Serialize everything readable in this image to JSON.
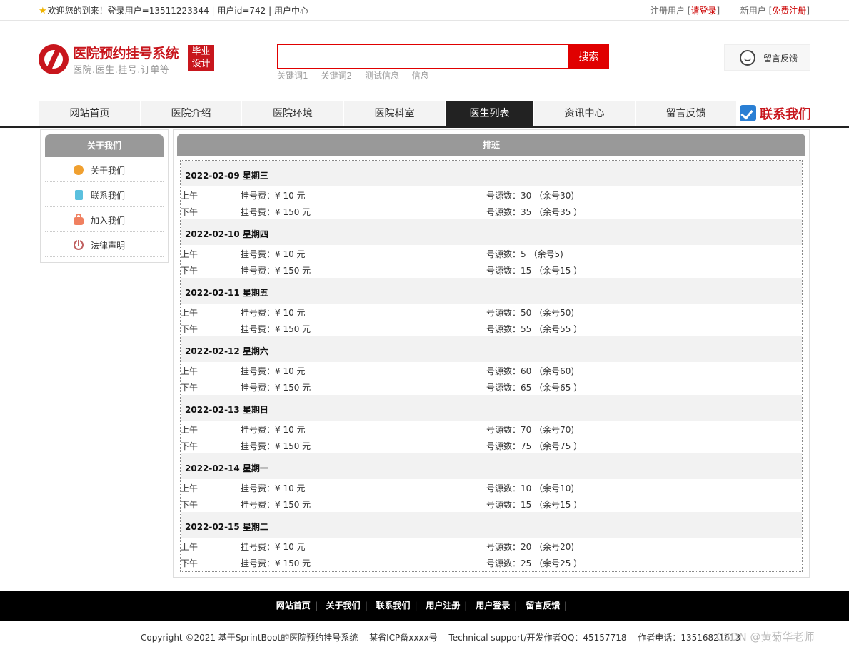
{
  "topbar": {
    "welcome": "欢迎您的到来！登录用户=13511223344 | 用户id=742 | 用户中心",
    "register_prefix": "注册用户 [",
    "login_link": "请登录",
    "bracket_close": "]",
    "newuser_prefix": "新用户 [",
    "free_register_link": "免费注册",
    "star_icon": "star-icon"
  },
  "logo": {
    "title": "医院预约挂号系统",
    "subtitle": "医院.医生.挂号.订单等",
    "badge_line1": "毕业",
    "badge_line2": "设计"
  },
  "search": {
    "placeholder": "",
    "button_label": "搜索",
    "keywords": [
      "关键词1",
      "关键词2",
      "测试信息",
      "信息"
    ]
  },
  "feedback": {
    "label": "留言反馈"
  },
  "nav": {
    "items": [
      "网站首页",
      "医院介绍",
      "医院环境",
      "医院科室",
      "医生列表",
      "资讯中心",
      "留言反馈"
    ],
    "active": "医生列表",
    "contact_label": "联系我们"
  },
  "sidebar": {
    "title": "关于我们",
    "items": [
      "关于我们",
      "联系我们",
      "加入我们",
      "法律声明"
    ]
  },
  "main": {
    "title": "排班",
    "days": [
      {
        "date": "2022-02-09 星期三",
        "slots": [
          {
            "period": "上午",
            "fee": "挂号费：¥ 10 元",
            "source": "号源数：30 （余号30)"
          },
          {
            "period": "下午",
            "fee": "挂号费：¥ 150 元",
            "source": "号源数：35 （余号35 ）"
          }
        ]
      },
      {
        "date": "2022-02-10 星期四",
        "slots": [
          {
            "period": "上午",
            "fee": "挂号费：¥ 10 元",
            "source": "号源数：5 （余号5)"
          },
          {
            "period": "下午",
            "fee": "挂号费：¥ 150 元",
            "source": "号源数：15 （余号15 ）"
          }
        ]
      },
      {
        "date": "2022-02-11 星期五",
        "slots": [
          {
            "period": "上午",
            "fee": "挂号费：¥ 10 元",
            "source": "号源数：50 （余号50)"
          },
          {
            "period": "下午",
            "fee": "挂号费：¥ 150 元",
            "source": "号源数：55 （余号55 ）"
          }
        ]
      },
      {
        "date": "2022-02-12 星期六",
        "slots": [
          {
            "period": "上午",
            "fee": "挂号费：¥ 10 元",
            "source": "号源数：60 （余号60)"
          },
          {
            "period": "下午",
            "fee": "挂号费：¥ 150 元",
            "source": "号源数：65 （余号65 ）"
          }
        ]
      },
      {
        "date": "2022-02-13 星期日",
        "slots": [
          {
            "period": "上午",
            "fee": "挂号费：¥ 10 元",
            "source": "号源数：70 （余号70)"
          },
          {
            "period": "下午",
            "fee": "挂号费：¥ 150 元",
            "source": "号源数：75 （余号75 ）"
          }
        ]
      },
      {
        "date": "2022-02-14 星期一",
        "slots": [
          {
            "period": "上午",
            "fee": "挂号费：¥ 10 元",
            "source": "号源数：10 （余号10)"
          },
          {
            "period": "下午",
            "fee": "挂号费：¥ 150 元",
            "source": "号源数：15 （余号15 ）"
          }
        ]
      },
      {
        "date": "2022-02-15 星期二",
        "slots": [
          {
            "period": "上午",
            "fee": "挂号费：¥ 10 元",
            "source": "号源数：20 （余号20)"
          },
          {
            "period": "下午",
            "fee": "挂号费：¥ 150 元",
            "source": "号源数：25 （余号25 ）"
          }
        ]
      }
    ]
  },
  "footer": {
    "links": [
      "网站首页",
      "关于我们",
      "联系我们",
      "用户注册",
      "用户登录",
      "留言反馈"
    ],
    "separator": "|",
    "copyright": "Copyright ©2021 基于SprintBoot的医院预约挂号系统",
    "icp": "某省ICP备xxxx号",
    "support": "Technical support/开发作者QQ：45157718",
    "phone": "作者电话：13516821613",
    "watermark": "CSDN @黄菊华老师"
  },
  "colors": {
    "brand_red": "#c8161d",
    "search_red": "#e00000",
    "nav_active_bg": "#222222",
    "panel_header_bg": "#999999"
  }
}
